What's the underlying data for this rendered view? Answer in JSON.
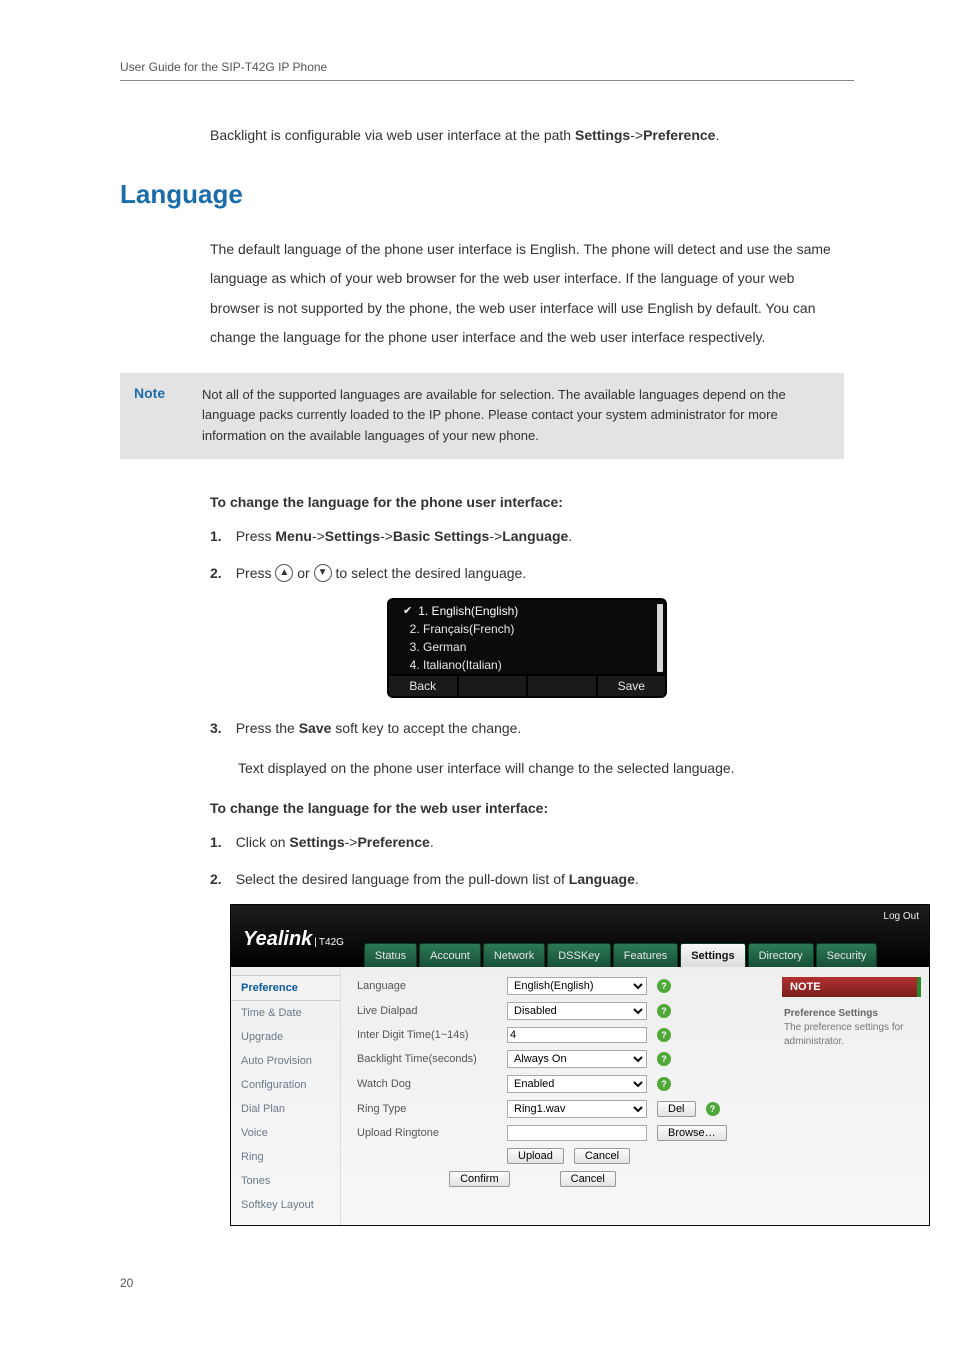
{
  "header": "User Guide for the SIP-T42G IP Phone",
  "intro": "Backlight is configurable via web user interface at the path ",
  "intro_path1": "Settings",
  "intro_sep": "->",
  "intro_path2": "Preference",
  "intro_end": ".",
  "section_title": "Language",
  "para1": "The default language of the phone user interface is English. The phone will detect and use the same language as which of your web browser for the web user interface. If the language of your web browser is not supported by the phone, the web user interface will use English by default. You can change the language for the phone user interface and the web user interface respectively.",
  "note_label": "Note",
  "note_text": "Not all of the supported languages are available for selection. The available languages depend on the language packs currently loaded to the IP phone. Please contact your system administrator for more information on the available languages of your new phone.",
  "subhead1": "To change the language for the phone user interface:",
  "steps1": {
    "n1": "1.",
    "t1_a": "Press ",
    "t1_menu": "Menu",
    "t1_sep": "->",
    "t1_settings": "Settings",
    "t1_basic": "Basic Settings",
    "t1_lang": "Language",
    "t1_end": ".",
    "n2": "2.",
    "t2_a": "Press ",
    "t2_b": " or ",
    "t2_c": " to select the desired language.",
    "n3": "3.",
    "t3_a": "Press the ",
    "t3_save": "Save",
    "t3_b": " soft key to accept the change."
  },
  "lcd": {
    "items": [
      "1. English(English)",
      "2. Français(French)",
      "3. German",
      "4. Italiano(Italian)"
    ],
    "sk_back": "Back",
    "sk_save": "Save"
  },
  "post_step": "Text displayed on the phone user interface will change to the selected language.",
  "subhead2": "To change the language for the web user interface:",
  "steps2": {
    "n1": "1.",
    "t1_a": "Click on ",
    "t1_settings": "Settings",
    "t1_sep": "->",
    "t1_pref": "Preference",
    "t1_end": ".",
    "n2": "2.",
    "t2_a": "Select the desired language from the pull-down list of ",
    "t2_lang": "Language",
    "t2_end": "."
  },
  "webui": {
    "logo": "Yealink",
    "model": "T42G",
    "logout": "Log Out",
    "tabs": [
      "Status",
      "Account",
      "Network",
      "DSSKey",
      "Features",
      "Settings",
      "Directory",
      "Security"
    ],
    "active_tab": "Settings",
    "side": [
      "Preference",
      "Time & Date",
      "Upgrade",
      "Auto Provision",
      "Configuration",
      "Dial Plan",
      "Voice",
      "Ring",
      "Tones",
      "Softkey Layout"
    ],
    "active_side": "Preference",
    "form": {
      "language_label": "Language",
      "language_value": "English(English)",
      "live_dialpad_label": "Live Dialpad",
      "live_dialpad_value": "Disabled",
      "inter_digit_label": "Inter Digit Time(1~14s)",
      "inter_digit_value": "4",
      "backlight_label": "Backlight Time(seconds)",
      "backlight_value": "Always On",
      "watchdog_label": "Watch Dog",
      "watchdog_value": "Enabled",
      "ringtype_label": "Ring Type",
      "ringtype_value": "Ring1.wav",
      "upload_label": "Upload Ringtone",
      "del_btn": "Del",
      "browse_btn": "Browse…",
      "upload_btn": "Upload",
      "cancel_btn": "Cancel",
      "confirm_btn": "Confirm",
      "cancel_btn2": "Cancel"
    },
    "notepanel": {
      "head": "NOTE",
      "title": "Preference Settings",
      "body": "The preference settings for administrator."
    }
  },
  "page_num": "20"
}
